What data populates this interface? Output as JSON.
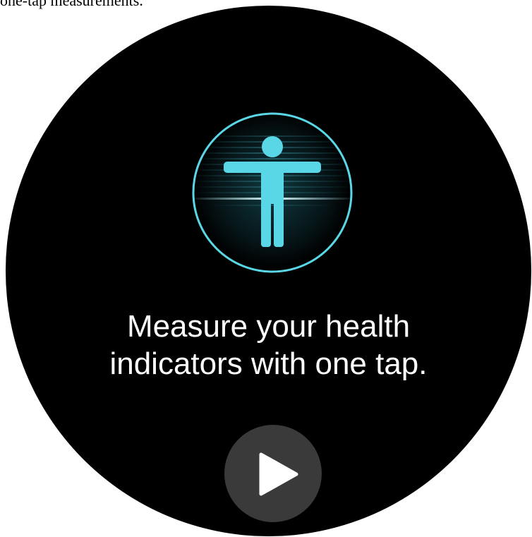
{
  "caption": {
    "text": "one-tap measurements."
  },
  "screen": {
    "icon": "body-scan-icon",
    "headline_line1": "Measure your health",
    "headline_line2": "indicators with one tap.",
    "action_icon": "play-icon"
  },
  "colors": {
    "background": "#000000",
    "accent": "#5ad7e6",
    "text": "#ffffff",
    "button": "#3a3a3a"
  }
}
